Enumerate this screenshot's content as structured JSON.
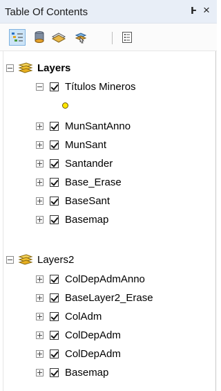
{
  "header": {
    "title": "Table Of Contents",
    "pin_glyph": "Ͱ",
    "close_glyph": "×"
  },
  "toolbar": {
    "buttons": [
      {
        "icon": "list-by-drawing-order-icon",
        "active": true
      },
      {
        "icon": "list-by-source-icon",
        "active": false
      },
      {
        "icon": "list-by-visibility-icon",
        "active": false
      },
      {
        "icon": "list-by-selection-icon",
        "active": false
      },
      {
        "icon": "options-icon",
        "active": false
      }
    ]
  },
  "groups": [
    {
      "label": "Layers",
      "bold": true,
      "layers": [
        {
          "label": "Títulos Mineros",
          "checked": true,
          "expanded": true
        },
        {
          "label": "MunSantAnno",
          "checked": true,
          "expanded": false
        },
        {
          "label": "MunSant",
          "checked": true,
          "expanded": false
        },
        {
          "label": "Santander",
          "checked": true,
          "expanded": false
        },
        {
          "label": "Base_Erase",
          "checked": true,
          "expanded": false
        },
        {
          "label": "BaseSant",
          "checked": true,
          "expanded": false
        },
        {
          "label": "Basemap",
          "checked": true,
          "expanded": false
        }
      ]
    },
    {
      "label": "Layers2",
      "bold": false,
      "layers": [
        {
          "label": "ColDepAdmAnno",
          "checked": true,
          "expanded": false
        },
        {
          "label": "BaseLayer2_Erase",
          "checked": true,
          "expanded": false
        },
        {
          "label": "ColAdm",
          "checked": true,
          "expanded": false
        },
        {
          "label": "ColDepAdm",
          "checked": true,
          "expanded": false
        },
        {
          "label": "ColDepAdm",
          "checked": true,
          "expanded": false
        },
        {
          "label": "Basemap",
          "checked": true,
          "expanded": false
        }
      ]
    }
  ],
  "colors": {
    "titlebar_bg": "#e8eef7",
    "group_layer_icon": "#f2c230",
    "point_symbol": "#ffe600",
    "active_tool_bg": "#cce4f7"
  }
}
